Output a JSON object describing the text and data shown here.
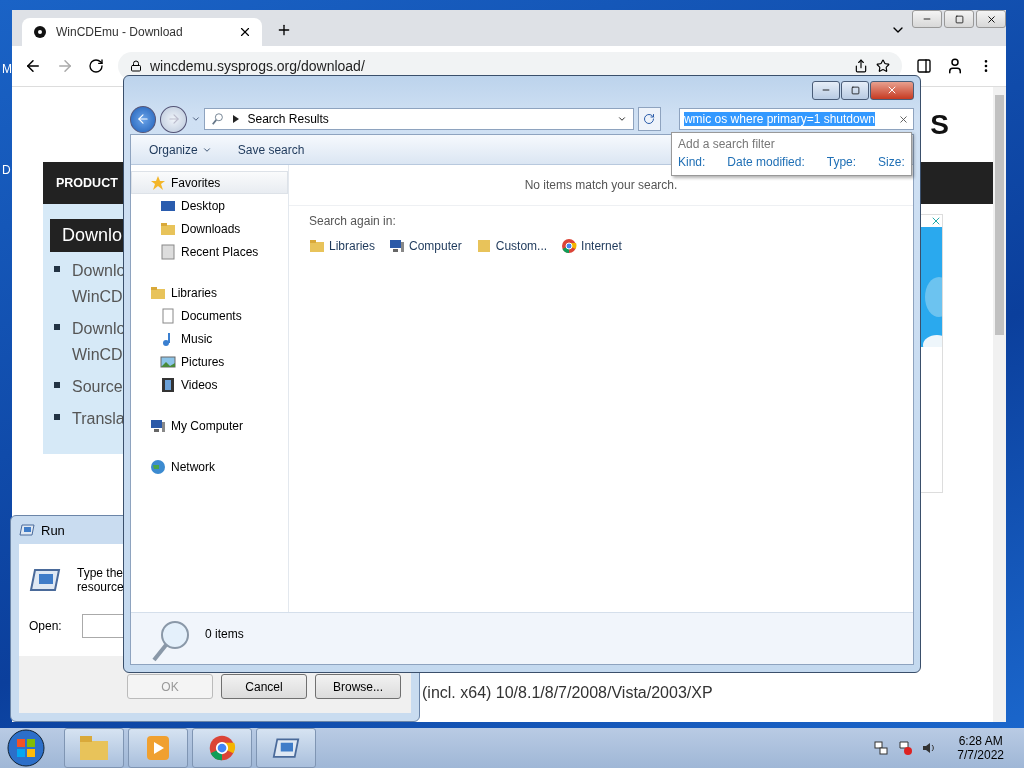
{
  "desktop": {
    "labels": [
      "M",
      "D"
    ]
  },
  "browser": {
    "tab": {
      "title": "WinCDEmu - Download"
    },
    "address": "wincdemu.sysprogs.org/download/",
    "page": {
      "logo_fragment": "S",
      "nav": [
        "PRODUCT"
      ],
      "heading": "Downlo",
      "list": [
        {
          "lines": [
            "Downlo",
            "WinCD"
          ]
        },
        {
          "lines": [
            "Downlo",
            "WinCD"
          ]
        },
        {
          "lines": [
            "Source"
          ]
        },
        {
          "lines": [
            "Transla"
          ]
        }
      ],
      "footer_text": "(incl. x64) 10/8.1/8/7/2008/Vista/2003/XP"
    }
  },
  "run_dialog": {
    "title": "Run",
    "prompt": [
      "Type the",
      "resource"
    ],
    "open_label": "Open:",
    "buttons": [
      {
        "label": "OK",
        "disabled": true
      },
      {
        "label": "Cancel",
        "disabled": false
      },
      {
        "label": "Browse...",
        "disabled": false
      }
    ]
  },
  "explorer": {
    "back_enabled": true,
    "forward_enabled": false,
    "breadcrumb": "Search Results",
    "search": {
      "value": "wmic os where primary=1 shutdown",
      "value_selected": true
    },
    "search_filter": {
      "title": "Add a search filter",
      "filters": [
        "Kind:",
        "Date modified:",
        "Type:",
        "Size:"
      ]
    },
    "toolbar": [
      "Organize",
      "Save search"
    ],
    "nav": [
      {
        "label": "Favorites",
        "selected": true,
        "children": [
          {
            "label": "Desktop",
            "selected": false
          },
          {
            "label": "Downloads",
            "selected": false
          },
          {
            "label": "Recent Places",
            "selected": false
          }
        ]
      },
      {
        "label": "Libraries",
        "selected": false,
        "children": [
          {
            "label": "Documents",
            "selected": false
          },
          {
            "label": "Music",
            "selected": false
          },
          {
            "label": "Pictures",
            "selected": false
          },
          {
            "label": "Videos",
            "selected": false
          }
        ]
      },
      {
        "label": "My Computer",
        "selected": false
      },
      {
        "label": "Network",
        "selected": false
      }
    ],
    "message": "No items match your search.",
    "search_again_label": "Search again in:",
    "search_again": [
      "Libraries",
      "Computer",
      "Custom...",
      "Internet"
    ],
    "status": "0 items"
  },
  "taskbar": {
    "time": "6:28 AM",
    "date": "7/7/2022"
  }
}
